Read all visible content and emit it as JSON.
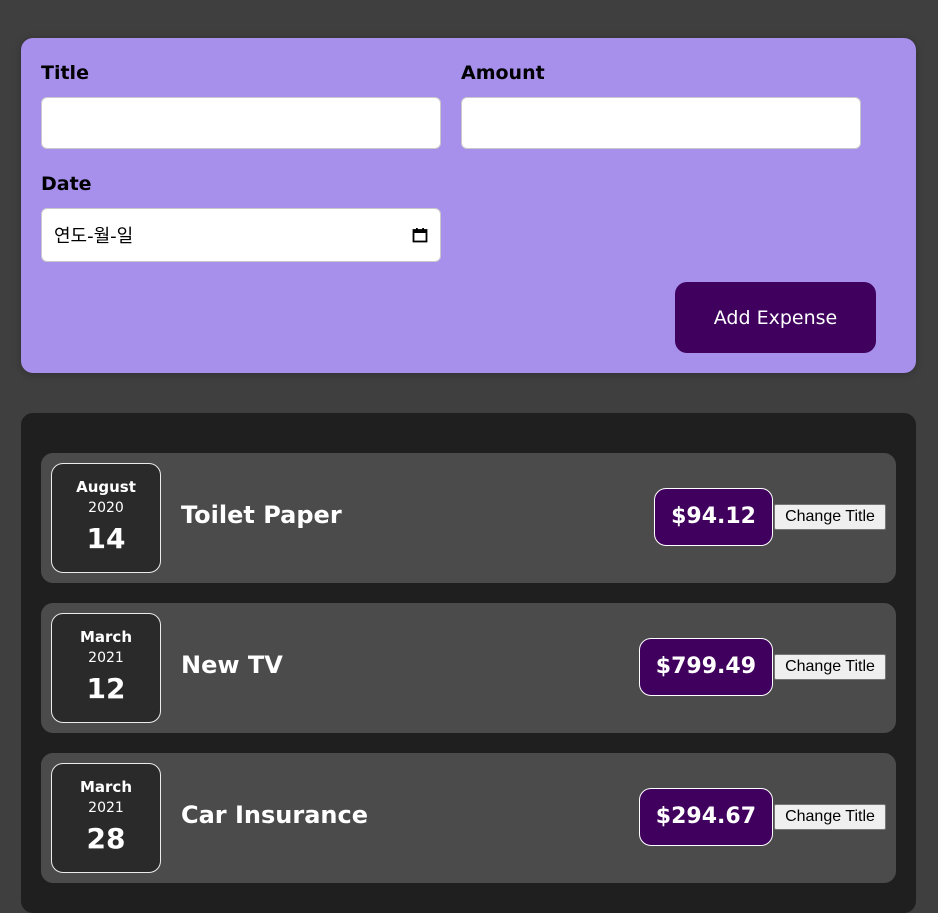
{
  "form": {
    "title_label": "Title",
    "amount_label": "Amount",
    "date_label": "Date",
    "title_value": "",
    "amount_value": "",
    "date_placeholder": "연도-월-일",
    "add_button_label": "Add Expense"
  },
  "expenses": [
    {
      "month": "August",
      "year": "2020",
      "day": "14",
      "title": "Toilet Paper",
      "amount": "$94.12",
      "button_label": "Change Title"
    },
    {
      "month": "March",
      "year": "2021",
      "day": "12",
      "title": "New TV",
      "amount": "$799.49",
      "button_label": "Change Title"
    },
    {
      "month": "March",
      "year": "2021",
      "day": "28",
      "title": "Car Insurance",
      "amount": "$294.67",
      "button_label": "Change Title"
    }
  ],
  "colors": {
    "background": "#3f3f3f",
    "form_panel": "#a78fec",
    "accent": "#40005d",
    "list_panel": "#1f1f1f",
    "item": "#4b4b4b"
  }
}
